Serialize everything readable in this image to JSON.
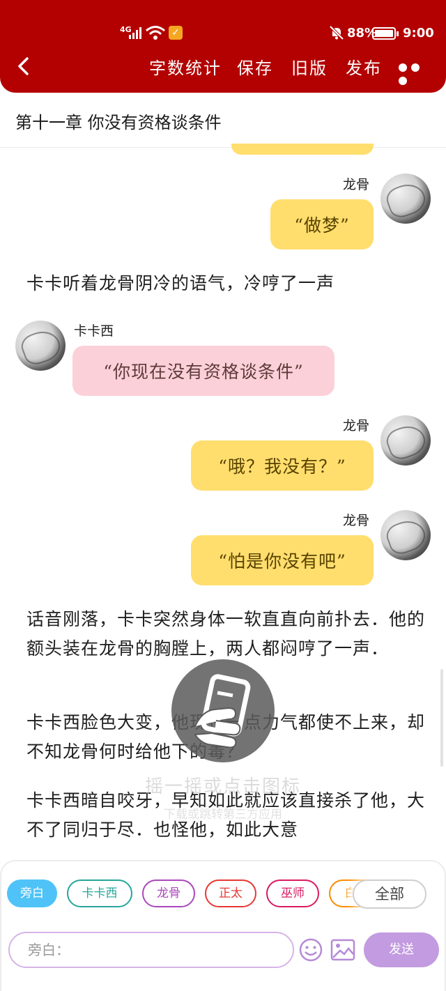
{
  "status_bar": {
    "signal": "4G",
    "battery": "88%",
    "time": "9:00"
  },
  "toolbar": {
    "word_count": "字数统计",
    "save": "保存",
    "old_version": "旧版",
    "publish": "发布"
  },
  "chapter_title": "第十一章 你没有资格谈条件",
  "messages": [
    {
      "speaker": "龙骨",
      "text": "“做梦”"
    },
    {
      "narration": "卡卡听着龙骨阴冷的语气，冷哼了一声"
    },
    {
      "speaker": "卡卡西",
      "text": "“你现在没有资格谈条件”"
    },
    {
      "speaker": "龙骨",
      "text": "“哦？我没有？”"
    },
    {
      "speaker": "龙骨",
      "text": "“怕是你没有吧”"
    },
    {
      "narration": "话音刚落，卡卡突然身体一软直直向前扑去．他的额头装在龙骨的胸膛上，两人都闷哼了一声．"
    },
    {
      "narration": "卡卡西脸色大变，他现在一点力气都使不上来，却不知龙骨何时给他下的毒？"
    },
    {
      "narration": "卡卡西暗自咬牙，早知如此就应该直接杀了他，大不了同归于尽．也怪他，如此大意"
    }
  ],
  "overlay": {
    "hint": "摇一摇或点击图标",
    "sub": "下载或跳转第三方应用"
  },
  "roles": [
    {
      "label": "旁白",
      "color": "#4fc3f7",
      "selected": true
    },
    {
      "label": "卡卡西",
      "color": "#26a69a"
    },
    {
      "label": "龙骨",
      "color": "#ab47bc"
    },
    {
      "label": "正太",
      "color": "#e53935"
    },
    {
      "label": "巫师",
      "color": "#d81b60"
    },
    {
      "label": "白",
      "color": "#fb8c00"
    }
  ],
  "all_button": "全部",
  "composer": {
    "placeholder": "旁白：",
    "send": "发送"
  }
}
